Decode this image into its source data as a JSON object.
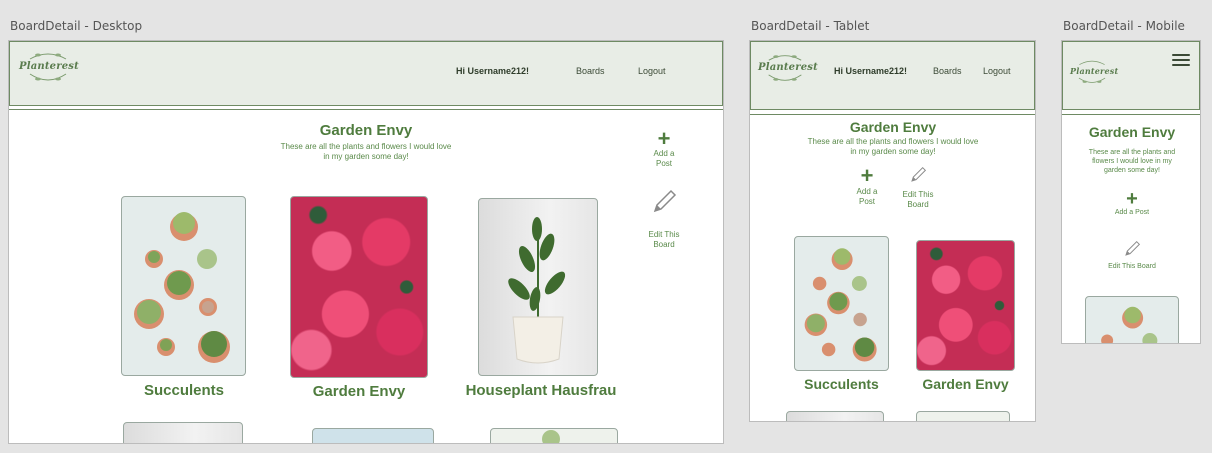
{
  "labels": {
    "desktop": "BoardDetail - Desktop",
    "tablet": "BoardDetail - Tablet",
    "mobile": "BoardDetail - Mobile"
  },
  "brand": {
    "name": "Planterest"
  },
  "nav": {
    "greeting": "Hi Username212!",
    "boards": "Boards",
    "logout": "Logout"
  },
  "board": {
    "title": "Garden Envy",
    "description": "These are all the plants and flowers I would love in my garden some day!",
    "description_desktop_l1": "These are all the plants and flowers I would love",
    "description_desktop_l2": "in my garden some day!",
    "description_mobile_l1": "These are all the plants and",
    "description_mobile_l2": "flowers I would love in my",
    "description_mobile_l3": "garden some day!"
  },
  "actions": {
    "add_post_l1": "Add a",
    "add_post_l2": "Post",
    "add_post": "Add a Post",
    "edit_l1": "Edit This",
    "edit_l2": "Board",
    "edit": "Edit This Board"
  },
  "tiles": [
    {
      "label": "Succulents"
    },
    {
      "label": "Garden Envy"
    },
    {
      "label": "Houseplant Hausfrau"
    }
  ],
  "colors": {
    "accent": "#4f7c3e",
    "nav_bg": "#e8ede6",
    "nav_border": "#6e8a63"
  },
  "icons": {
    "menu": "hamburger-icon",
    "add": "plus-icon",
    "edit": "pencil-icon"
  }
}
